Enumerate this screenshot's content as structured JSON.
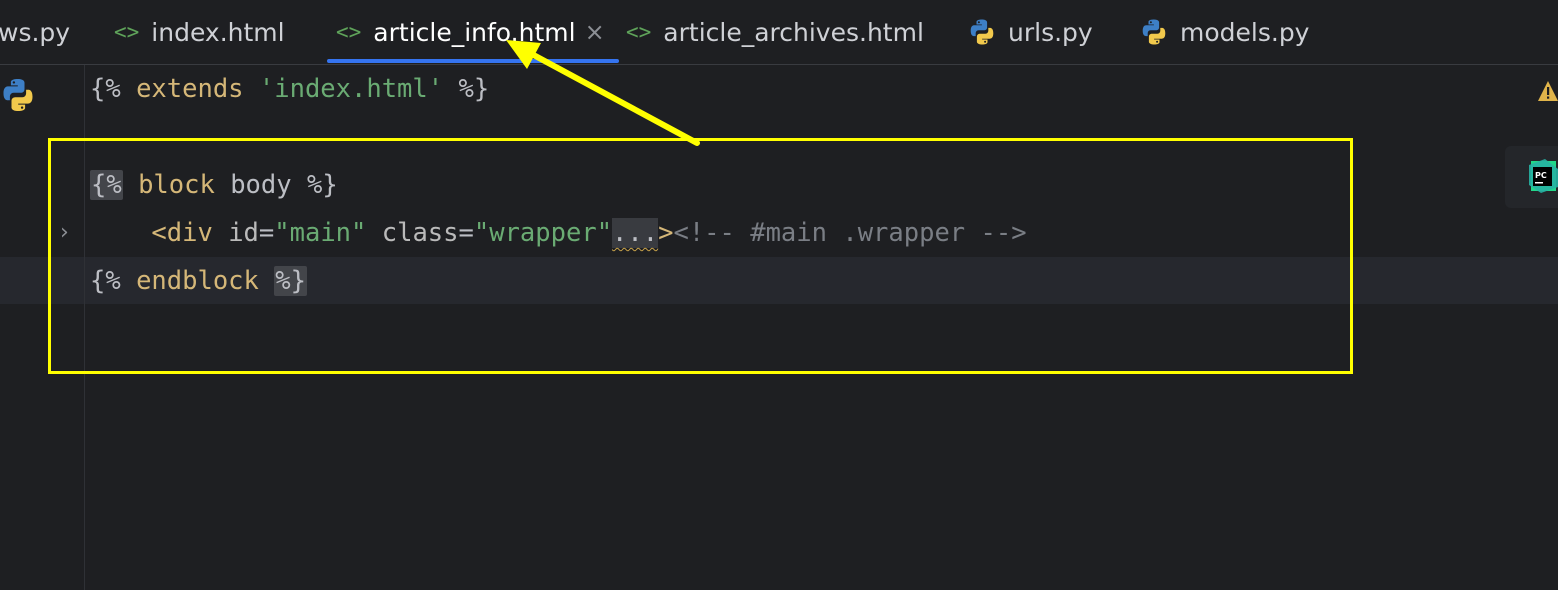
{
  "tabs": [
    {
      "label": "ws.py",
      "icon": "python-icon"
    },
    {
      "label": "index.html",
      "icon": "html-icon",
      "glyph": "<>"
    },
    {
      "label": "article_info.html",
      "icon": "html-icon",
      "glyph": "<>",
      "active": true,
      "close": "×"
    },
    {
      "label": "article_archives.html",
      "icon": "html-icon",
      "glyph": "<>"
    },
    {
      "label": "urls.py",
      "icon": "python-icon"
    },
    {
      "label": "models.py",
      "icon": "python-icon"
    }
  ],
  "code": {
    "line1": {
      "open": "{%",
      "kw": " extends ",
      "str": "'index.html'",
      "close": " %}"
    },
    "line3": {
      "open": "{%",
      "kw": " block ",
      "name": "body",
      "close": " %}"
    },
    "line4": {
      "indent": "    ",
      "tag_open": "<div",
      "attr1": " id",
      "eq1": "=",
      "val1": "\"main\"",
      "attr2": " class",
      "eq2": "=",
      "val2": "\"wrapper\"",
      "dots": "...",
      "tag_close": ">",
      "comment": "<!-- #main .wrapper -->"
    },
    "line5": {
      "open": "{%",
      "kw": " endblock ",
      "close": "%}"
    }
  },
  "fold_chevron": "›",
  "colors": {
    "highlight": "#ffff00",
    "tab_underline": "#3574f0",
    "background": "#1e1f22"
  }
}
